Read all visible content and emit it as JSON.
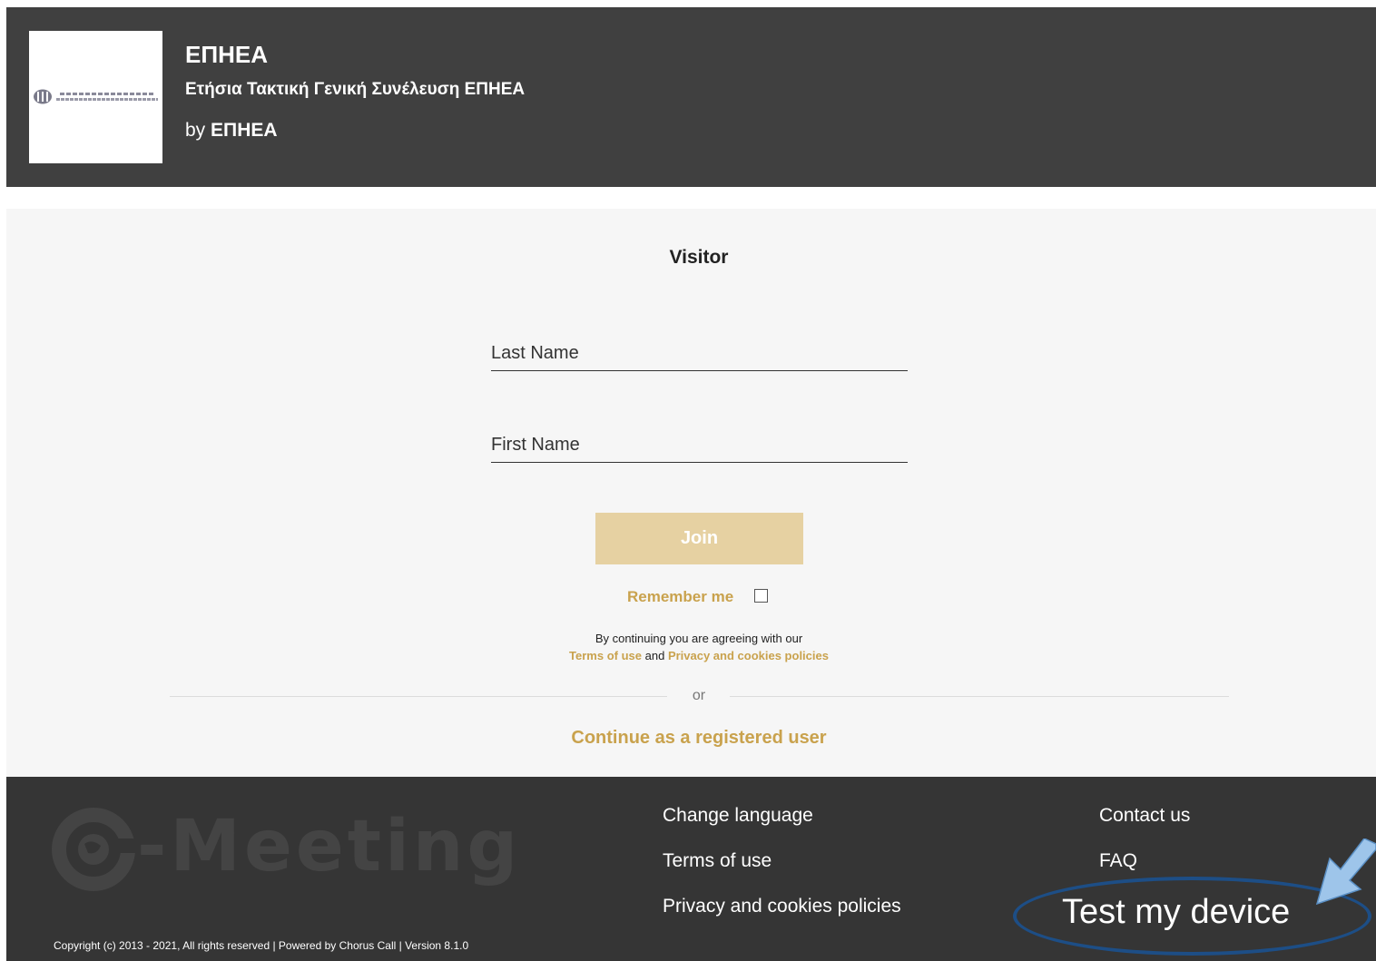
{
  "header": {
    "org_name": "ΕΠΗΕΑ",
    "event_title": "Ετήσια Τακτική Γενική Συνέλευση ΕΠΗΕΑ",
    "by_prefix": "by",
    "by_org": "ΕΠΗΕΑ"
  },
  "form": {
    "title": "Visitor",
    "last_name_placeholder": "Last Name",
    "last_name_value": "",
    "first_name_placeholder": "First Name",
    "first_name_value": "",
    "join_label": "Join",
    "remember_label": "Remember me",
    "remember_checked": false,
    "agree_text": "By continuing you are agreeing with our",
    "terms_link": "Terms of use",
    "and_text": "and",
    "privacy_link": "Privacy and cookies policies",
    "or_text": "or",
    "registered_link": "Continue as a registered user"
  },
  "footer": {
    "brand": "-Meeting",
    "links_col1": [
      "Change language",
      "Terms of use",
      "Privacy and cookies policies"
    ],
    "links_col2": [
      "Contact us",
      "FAQ"
    ],
    "test_device": "Test my device",
    "copyright": "Copyright (c) 2013 - 2021, All rights reserved | Powered by Chorus Call | Version 8.1.0"
  },
  "colors": {
    "header_bg": "#404040",
    "accent_gold": "#c9a24d",
    "join_button_bg": "#e6d1a2",
    "footer_bg": "#353535",
    "highlight_oval": "#1d4e86",
    "arrow_fill": "#9ec5ea"
  },
  "icons": {
    "org_logo": "org-emblem-icon",
    "brand_logo": "globe-e-icon",
    "checkbox": "checkbox-icon",
    "pointer": "arrow-icon"
  }
}
